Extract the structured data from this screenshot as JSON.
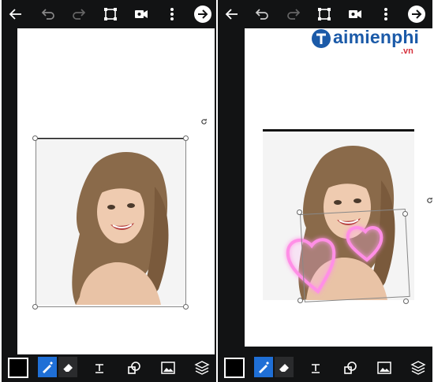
{
  "watermark": {
    "brand": "aimienphi",
    "suffix": ".vn"
  },
  "icons": {
    "back": "back-arrow-icon",
    "undo": "undo-icon",
    "redo": "redo-icon",
    "crop": "crop-icon",
    "video": "video-camera-icon",
    "more": "more-vertical-icon",
    "next": "next-arrow-icon",
    "color": "color-swatch-icon",
    "brush": "brush-icon",
    "eraser": "eraser-icon",
    "text": "text-icon",
    "shapes": "shapes-icon",
    "image": "add-image-icon",
    "layers": "layers-icon"
  },
  "colors": {
    "toolbar_bg": "#121314",
    "active_tool_bg": "#1f6fd6",
    "heart_glow": "#ff7fe0"
  }
}
